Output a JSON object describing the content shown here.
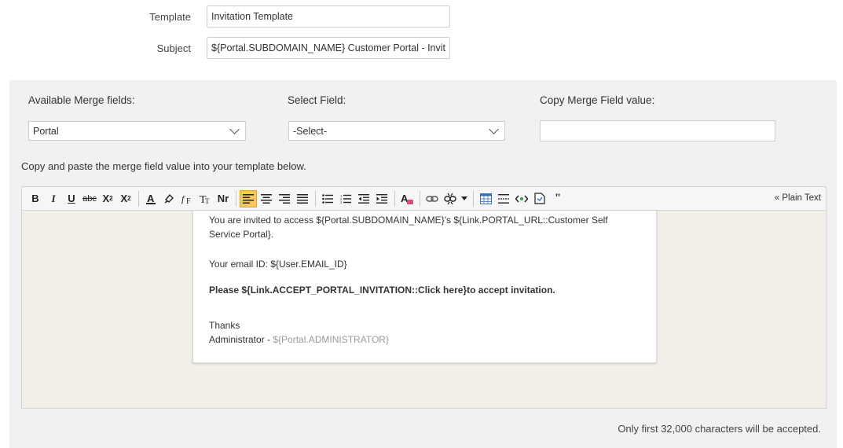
{
  "form": {
    "template_label": "Template",
    "template_value": "Invitation Template",
    "subject_label": "Subject",
    "subject_value": "${Portal.SUBDOMAIN_NAME} Customer Portal - Invitation"
  },
  "merge": {
    "available_label": "Available Merge fields:",
    "available_value": "Portal",
    "select_label": "Select Field:",
    "select_value": "-Select-",
    "copy_label": "Copy Merge Field value:",
    "copy_value": ""
  },
  "instruction": "Copy and paste the merge field value into your template below.",
  "toolbar": {
    "bold": "B",
    "italic": "I",
    "underline": "U",
    "strike": "abc",
    "subscript": "X",
    "superscript": "X",
    "plain_text": "« Plain Text"
  },
  "doc": {
    "line1": "You are invited to access ${Portal.SUBDOMAIN_NAME}'s ${Link.PORTAL_URL::Customer Self",
    "line2": "Service Portal}.",
    "email": "Your email ID: ${User.EMAIL_ID}",
    "accept": "Please ${Link.ACCEPT_PORTAL_INVITATION::Click here}to accept invitation.",
    "thanks": "Thanks",
    "admin_prefix": "Administrator - ",
    "admin_field": "${Portal.ADMINISTRATOR}"
  },
  "limit_note": "Only first 32,000 characters will be accepted.",
  "colors": {
    "panel_bg": "#f1f1f1",
    "active_button": "#f7c862"
  }
}
